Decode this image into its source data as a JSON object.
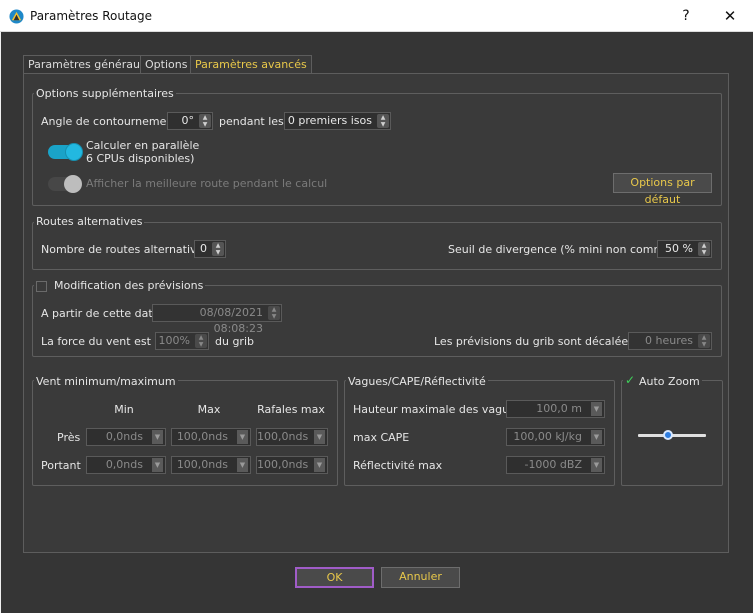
{
  "window": {
    "title": "Paramètres Routage",
    "help_label": "?",
    "close_label": "✕"
  },
  "tabs": [
    {
      "label": "Paramètres généraux"
    },
    {
      "label": "Options"
    },
    {
      "label": "Paramètres avancés",
      "active": true
    }
  ],
  "options_supp": {
    "title": "Options supplémentaires",
    "angle_label": "Angle de contournement",
    "angle_value": "0°",
    "pendant_label": "pendant les",
    "isos_value": "0 premiers isos",
    "parallel_line1": "Calculer en parallèle",
    "parallel_line2": "6 CPUs disponibles)",
    "parallel_on": true,
    "best_route_label": "Afficher la meilleure route pendant le calcul",
    "best_route_on": false,
    "defaults_button": "Options par défaut"
  },
  "routes_alt": {
    "title": "Routes alternatives",
    "count_label": "Nombre de routes alternatives",
    "count_value": "0",
    "seuil_label": "Seuil de divergence (% mini non commun)",
    "seuil_value": "50 %"
  },
  "modif_prev": {
    "title": "Modification des prévisions",
    "checked": false,
    "date_label": "A partir de cette date",
    "date_value": "08/08/2021 08:08:23",
    "force_label": "La force du vent est à",
    "force_value": "100%",
    "force_suffix": "du grib",
    "decal_label": "Les prévisions du grib sont décalées de",
    "decal_value": "0 heures"
  },
  "vent": {
    "title": "Vent minimum/maximum",
    "headers": [
      "Min",
      "Max",
      "Rafales max"
    ],
    "rows": [
      {
        "label": "Près",
        "values": [
          "0,0nds",
          "100,0nds",
          "100,0nds"
        ]
      },
      {
        "label": "Portant",
        "values": [
          "0,0nds",
          "100,0nds",
          "100,0nds"
        ]
      }
    ]
  },
  "vagues": {
    "title": "Vagues/CAPE/Réflectivité",
    "rows": [
      {
        "label": "Hauteur maximale des vagues",
        "value": "100,0 m"
      },
      {
        "label": "max CAPE",
        "value": "100,00 kJ/kg"
      },
      {
        "label": "Réflectivité max",
        "value": "-1000 dBZ"
      }
    ]
  },
  "auto_zoom": {
    "title": "Auto Zoom",
    "checked": true,
    "slider_fraction": 0.43
  },
  "footer": {
    "ok_label": "OK",
    "cancel_label": "Annuler"
  },
  "colors": {
    "accent": "#e8c84a",
    "toggle_on": "#1aa3c8",
    "ok_border": "#a05cc8"
  }
}
